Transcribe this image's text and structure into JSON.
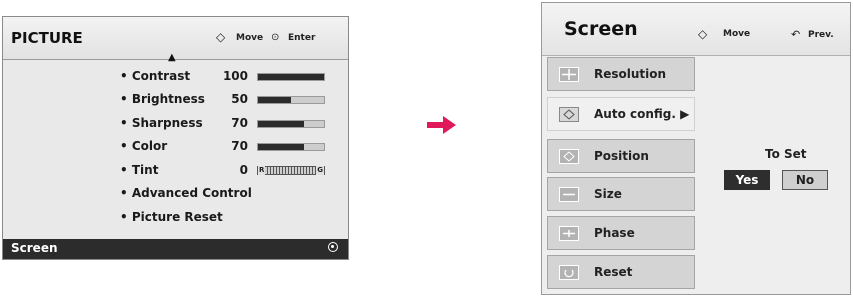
{
  "picture_menu": {
    "title": "PICTURE",
    "nav": {
      "move": "Move",
      "enter": "Enter",
      "move_icon": "◇",
      "enter_icon": "⊙"
    },
    "up_arrow": "▲",
    "items": [
      {
        "label": "• Contrast",
        "value": "100",
        "level": 100
      },
      {
        "label": "• Brightness",
        "value": "50",
        "level": 50
      },
      {
        "label": "• Sharpness",
        "value": "70",
        "level": 70
      },
      {
        "label": "• Color",
        "value": "70",
        "level": 70
      },
      {
        "label": "• Tint",
        "value": "0",
        "tint_left": "R",
        "tint_right": "G"
      },
      {
        "label": "• Advanced Control"
      },
      {
        "label": "• Picture Reset"
      }
    ],
    "selected_item": "Screen"
  },
  "screen_menu": {
    "title": "Screen",
    "nav": {
      "move": "Move",
      "prev": "Prev.",
      "move_icon": "◇",
      "prev_icon": "↶"
    },
    "items": [
      {
        "label": "Resolution"
      },
      {
        "label": "Auto config. ▶"
      },
      {
        "label": "Position"
      },
      {
        "label": "Size"
      },
      {
        "label": "Phase"
      },
      {
        "label": "Reset"
      }
    ],
    "selected_index": 1,
    "confirm": {
      "prompt": "To Set",
      "yes": "Yes",
      "no": "No"
    }
  },
  "colors": {
    "arrow": "#e0195a",
    "highlight_bar": "#2c2c2c"
  }
}
